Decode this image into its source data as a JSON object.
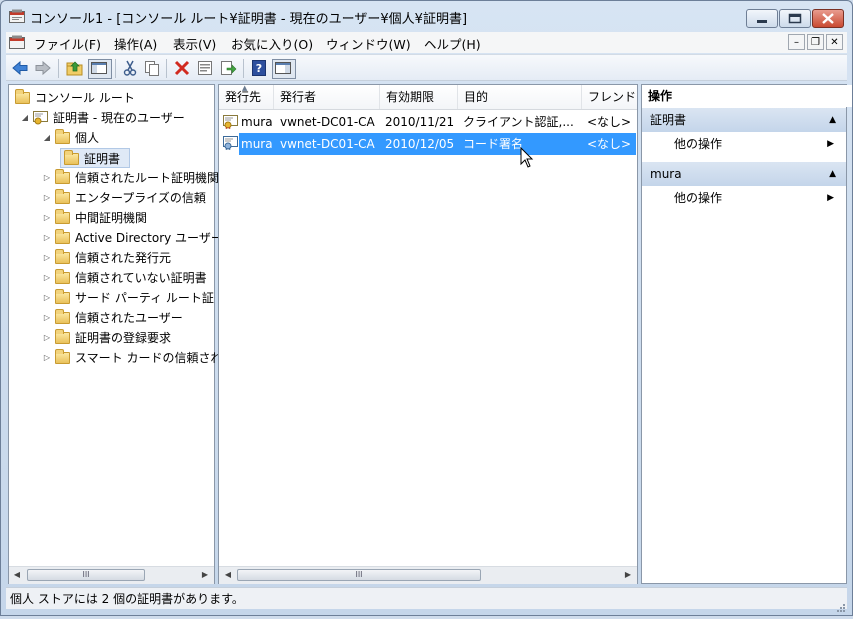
{
  "window": {
    "title": "コンソール1 - [コンソール ルート¥証明書 - 現在のユーザー¥個人¥証明書]"
  },
  "menubar": {
    "items": [
      "ファイル(F)",
      "操作(A)",
      "表示(V)",
      "お気に入り(O)",
      "ウィンドウ(W)",
      "ヘルプ(H)"
    ]
  },
  "toolbar": {
    "icons": [
      "back-arrow-icon",
      "forward-arrow-icon",
      "up-folder-icon",
      "show-hide-tree-icon",
      "cut-icon",
      "copy-icon",
      "delete-icon",
      "properties-icon",
      "export-icon",
      "help-icon",
      "show-action-pane-icon"
    ]
  },
  "tree": {
    "items": [
      {
        "label": "コンソール ルート",
        "level": 0,
        "twist": ""
      },
      {
        "label": "証明書 - 現在のユーザー",
        "level": 1,
        "twist": "◢"
      },
      {
        "label": "個人",
        "level": 2,
        "twist": "◢"
      },
      {
        "label": "証明書",
        "level": 3,
        "twist": ""
      },
      {
        "label": "信頼されたルート証明機関",
        "level": 2,
        "twist": "▷"
      },
      {
        "label": "エンタープライズの信頼",
        "level": 2,
        "twist": "▷"
      },
      {
        "label": "中間証明機関",
        "level": 2,
        "twist": "▷"
      },
      {
        "label": "Active Directory ユーザー",
        "level": 2,
        "twist": "▷"
      },
      {
        "label": "信頼された発行元",
        "level": 2,
        "twist": "▷"
      },
      {
        "label": "信頼されていない証明書",
        "level": 2,
        "twist": "▷"
      },
      {
        "label": "サード パーティ ルート証",
        "level": 2,
        "twist": "▷"
      },
      {
        "label": "信頼されたユーザー",
        "level": 2,
        "twist": "▷"
      },
      {
        "label": "証明書の登録要求",
        "level": 2,
        "twist": "▷"
      },
      {
        "label": "スマート カードの信頼され",
        "level": 2,
        "twist": "▷"
      }
    ],
    "scroll_thumb_glyph": "III"
  },
  "list": {
    "columns": [
      "発行先",
      "発行者",
      "有効期限",
      "目的",
      "フレンド"
    ],
    "rows": [
      {
        "issued_to": "mura",
        "issuer": "vwnet-DC01-CA",
        "expires": "2010/11/21",
        "purpose": "クライアント認証,...",
        "friendly": "<なし>",
        "selected": false
      },
      {
        "issued_to": "mura",
        "issuer": "vwnet-DC01-CA",
        "expires": "2010/12/05",
        "purpose": "コード署名",
        "friendly": "<なし>",
        "selected": true
      }
    ],
    "scroll_thumb_glyph": "III"
  },
  "actions": {
    "header": "操作",
    "sections": [
      {
        "title": "証明書",
        "item": "他の操作"
      },
      {
        "title": "mura",
        "item": "他の操作"
      }
    ]
  },
  "status": {
    "text": "個人 ストアには 2 個の証明書があります。"
  },
  "colors": {
    "selection": "#3399ff",
    "frame": "#cfdcec",
    "action_section": "#c4d5ea"
  }
}
